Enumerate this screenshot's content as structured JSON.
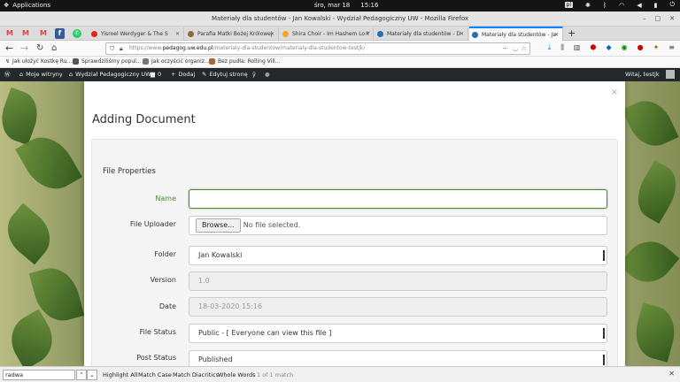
{
  "topbar": {
    "apps_label": "Applications",
    "date": "śro, mar 18",
    "time": "15:16",
    "lang": "pl"
  },
  "window": {
    "title": "Materiały dla studentów - Jan Kowalski - Wydział Pedagogiczny UW - Mozilla Firefox"
  },
  "tabs": [
    {
      "label": "Yisroel Werdyger & The S",
      "color": "#e62117"
    },
    {
      "label": "Parafia Matki Bożej Królowej",
      "color": "#8a6a3a"
    },
    {
      "label": "Shira Choir - Im Hashem Lo Y",
      "color": "#f5a623"
    },
    {
      "label": "Materiały dla studentów - D",
      "color": "#2b6cb0"
    },
    {
      "label": "Materiały dla studentów - Ja",
      "color": "#2b6cb0"
    }
  ],
  "url": {
    "prefix": "https://www.",
    "domain": "pedagog.uw.edu.pl",
    "path": "/materialy-dla-studentow/materialy-dla-studentow-testjk/"
  },
  "bookmarks": [
    "Jak ułożyć Kostkę Ru...",
    "Sprawdziliśmy popul...",
    "Jak oczyścić organiz...",
    "Bez pudła: Rolling Vill..."
  ],
  "wpbar": {
    "my_sites": "Moje witryny",
    "site": "Wydział Pedagogiczny UW",
    "comments": "0",
    "add": "Dodaj",
    "edit": "Edytuj stronę",
    "greeting": "Witaj, testjk"
  },
  "modal": {
    "title": "Adding Document",
    "section_title": "File Properties",
    "name_label": "Name",
    "uploader_label": "File Uploader",
    "browse_label": "Browse...",
    "no_file": "No file selected.",
    "folder_label": "Folder",
    "folder_value": "Jan Kowalski",
    "version_label": "Version",
    "version_value": "1.0",
    "date_label": "Date",
    "date_value": "18-03-2020 15:16",
    "status_label": "File Status",
    "status_value": "Public - [ Everyone can view this file ]",
    "post_status_label": "Post Status",
    "post_status_value": "Published"
  },
  "findbar": {
    "query": "radwa",
    "highlight_all": "Highlight All",
    "match_case": "Match Case",
    "diacritics": "Match Diacritics",
    "whole_words": "Whole Words",
    "count": "1 of 1 match"
  }
}
